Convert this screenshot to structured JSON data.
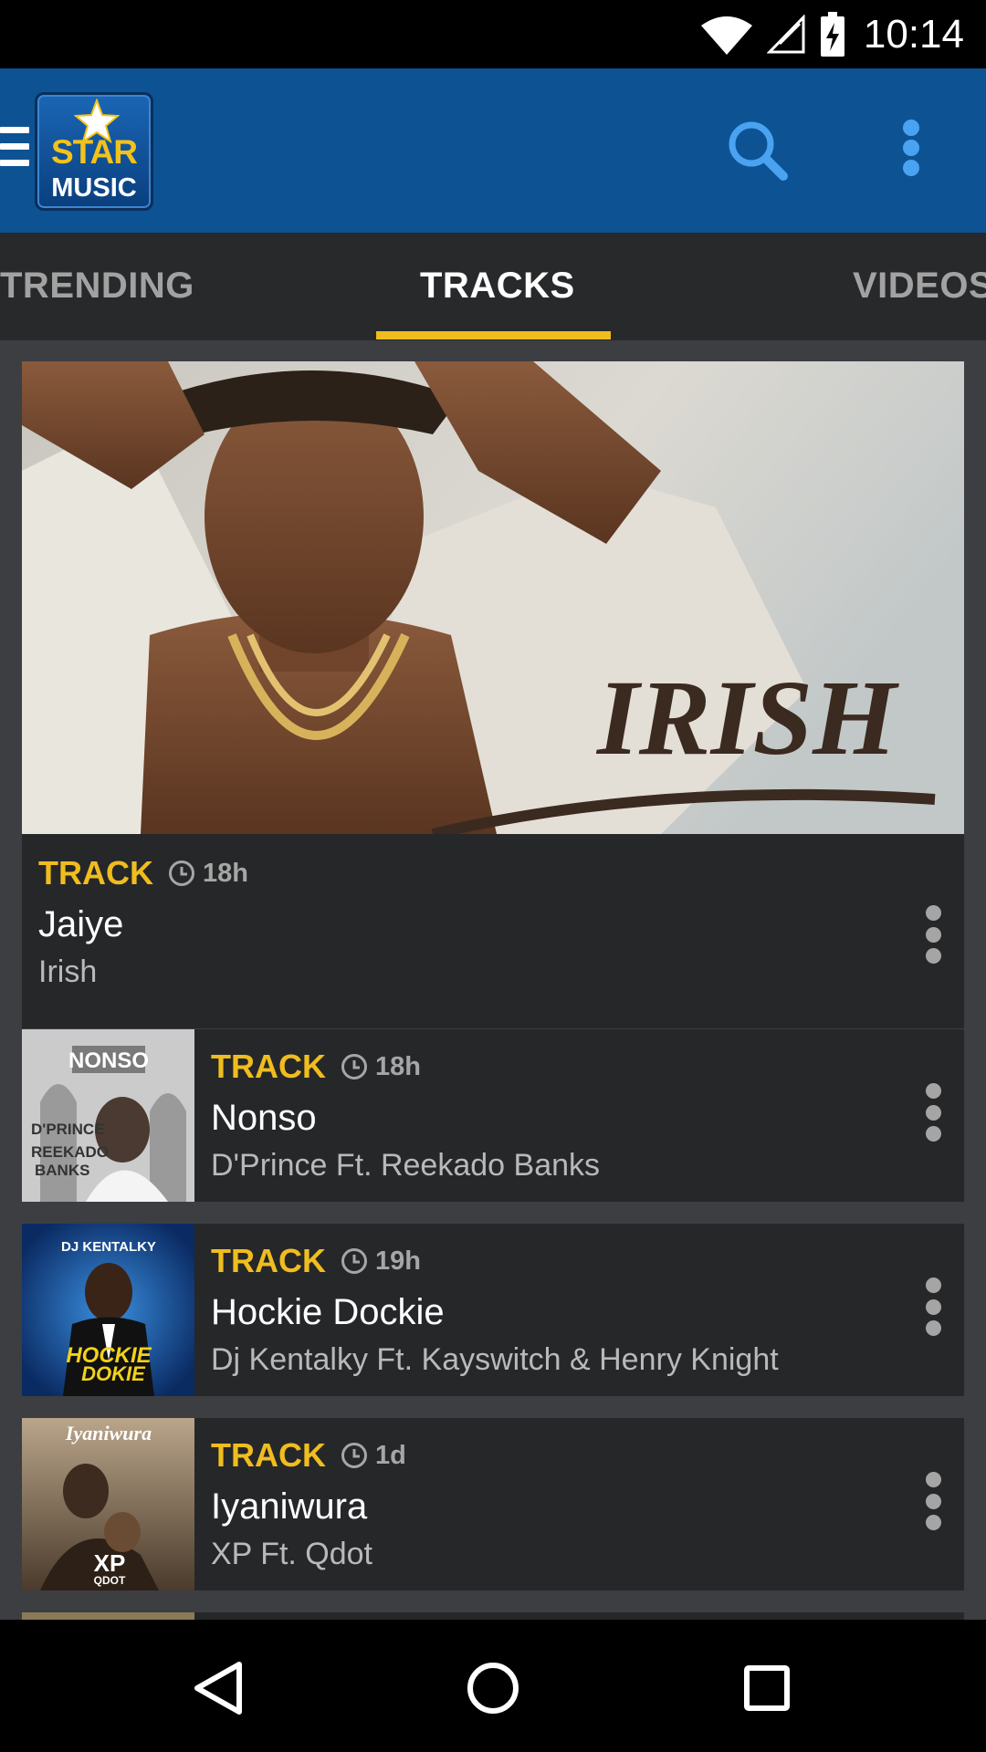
{
  "status_bar": {
    "time": "10:14"
  },
  "app_bar": {
    "logo_top": "STAR",
    "logo_bottom": "MUSIC",
    "icons": [
      "menu-icon",
      "search-icon",
      "overflow-menu-icon"
    ],
    "accent_color": "#0d5394",
    "search_color": "#4aa3f0"
  },
  "tabs": [
    {
      "label": "TRENDING"
    },
    {
      "label": "TRACKS"
    },
    {
      "label": "VIDEOS"
    }
  ],
  "active_tab": "TRACKS",
  "tab_indicator_color": "#f0bd1f",
  "hero_art_text": "IRISH",
  "tracks": [
    {
      "type": "TRACK",
      "age": "18h",
      "title": "Jaiye",
      "artist": "Irish"
    },
    {
      "type": "TRACK",
      "age": "18h",
      "title": "Nonso",
      "artist": "D'Prince Ft. Reekado Banks",
      "art": {
        "line1": "NONSO",
        "line2": "D'PRINCE",
        "line3": "REEKADO",
        "line4": "BANKS"
      }
    },
    {
      "type": "TRACK",
      "age": "19h",
      "title": "Hockie Dockie",
      "artist": "Dj Kentalky Ft. Kayswitch & Henry Knight",
      "art": {
        "line1": "DJ KENTALKY",
        "line2": "HOCKIE",
        "line3": "DOKIE"
      }
    },
    {
      "type": "TRACK",
      "age": "1d",
      "title": "Iyaniwura",
      "artist": "XP Ft. Qdot",
      "art": {
        "line1": "Iyaniwura",
        "line2": "XP",
        "line3": "QDOT"
      }
    }
  ],
  "nav_bar": {
    "icons": [
      "back-icon",
      "home-icon",
      "recents-icon"
    ]
  }
}
